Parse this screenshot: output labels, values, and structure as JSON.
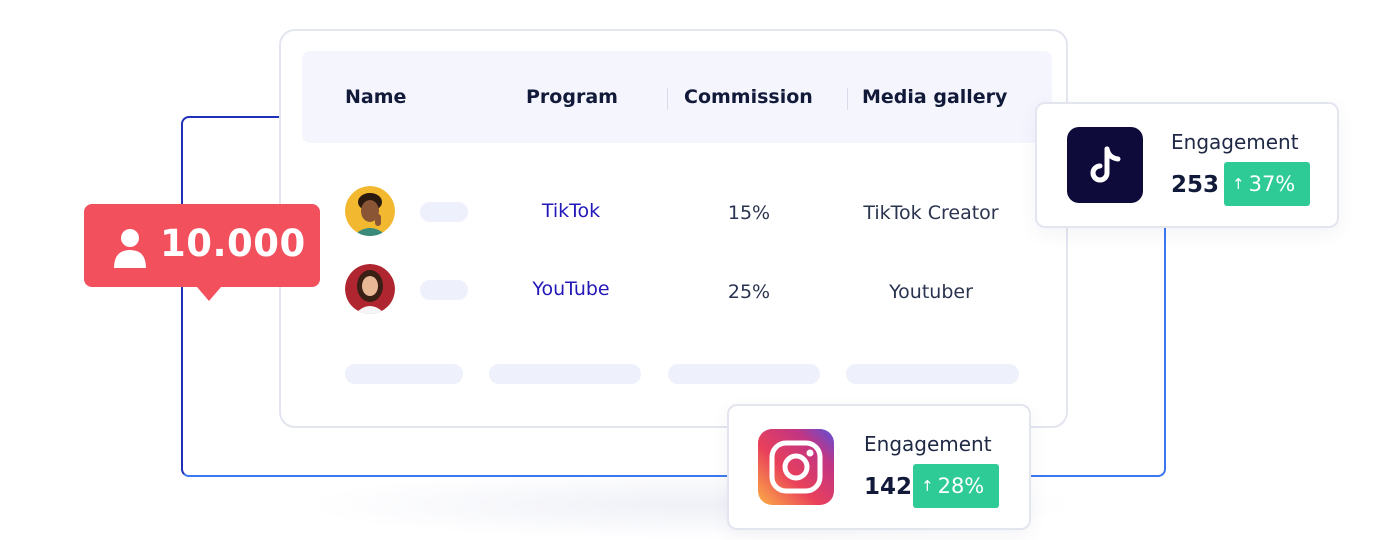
{
  "table": {
    "headers": [
      "Name",
      "Program",
      "Commission",
      "Media gallery"
    ],
    "rows": [
      {
        "program": "TikTok",
        "commission": "15%",
        "media": "TikTok Creator"
      },
      {
        "program": "YouTube",
        "commission": "25%",
        "media": "Youtuber"
      }
    ]
  },
  "followers_badge": {
    "count": "10.000",
    "icon": "user-icon",
    "color": "#f2505c"
  },
  "tiktok_card": {
    "icon": "tiktok-icon",
    "label": "Engagement",
    "value": "253",
    "change": "37%",
    "change_icon": "arrow-up-icon"
  },
  "instagram_card": {
    "icon": "instagram-icon",
    "label": "Engagement",
    "value": "142",
    "change": "28%",
    "change_icon": "arrow-up-icon"
  },
  "colors": {
    "accent_green": "#2ecb97",
    "link_blue": "#2318b8",
    "frame_blue": "#2a3fd0",
    "header_bg": "#f4f5fd"
  }
}
